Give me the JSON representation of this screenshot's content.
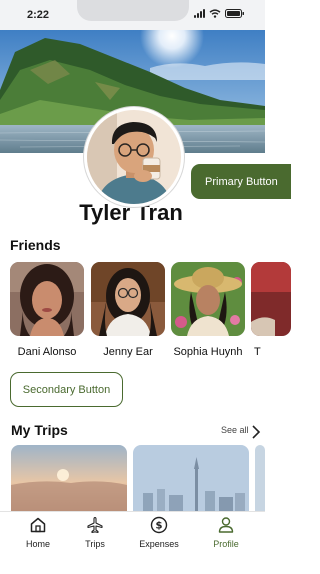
{
  "status_bar": {
    "time": "2:22",
    "icons": [
      "signal-icon",
      "wifi-icon",
      "battery-icon"
    ]
  },
  "profile": {
    "name": "Tyler Tran",
    "avatar_icon": "avatar"
  },
  "buttons": {
    "primary_label": "Primary Button",
    "secondary_label": "Secondary Button"
  },
  "friends": {
    "title": "Friends",
    "items": [
      {
        "name": "Dani Alonso"
      },
      {
        "name": "Jenny Ear"
      },
      {
        "name": "Sophia Huynh"
      },
      {
        "name": "T"
      }
    ]
  },
  "trips": {
    "title": "My Trips",
    "see_all": "See all",
    "chevron_icon": "chevron-right-icon"
  },
  "tab_bar": {
    "items": [
      {
        "label": "Home",
        "icon": "home-icon",
        "active": false
      },
      {
        "label": "Trips",
        "icon": "airplane-icon",
        "active": false
      },
      {
        "label": "Expenses",
        "icon": "dollar-icon",
        "active": false
      },
      {
        "label": "Profile",
        "icon": "person-icon",
        "active": true
      }
    ]
  },
  "colors": {
    "accent": "#4a6a2f",
    "background": "#ffffff",
    "text": "#111111"
  }
}
